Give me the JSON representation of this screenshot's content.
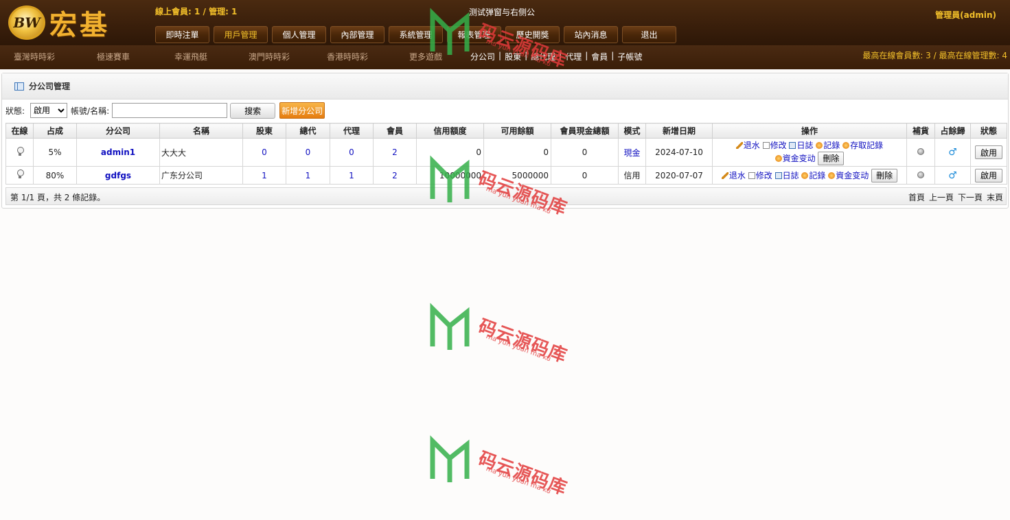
{
  "header": {
    "logo_badge": "BW",
    "logo_text": "宏基",
    "online_info": "線上會員: 1 / 管理: 1",
    "page_caption": "测试弹窗与右侧公",
    "admin_label": "管理員(admin)",
    "menu": [
      {
        "label": "即時注單",
        "active": false
      },
      {
        "label": "用戶管理",
        "active": true
      },
      {
        "label": "個人管理",
        "active": false
      },
      {
        "label": "內部管理",
        "active": false
      },
      {
        "label": "系統管理",
        "active": false
      },
      {
        "label": "報表管理",
        "active": false
      },
      {
        "label": "歷史開獎",
        "active": false
      },
      {
        "label": "站內消息",
        "active": false
      },
      {
        "label": "退出",
        "active": false
      }
    ]
  },
  "subnav": {
    "games": [
      "臺灣時時彩",
      "極速賽車",
      "幸運飛艇",
      "澳門時時彩",
      "香港時時彩",
      "更多遊戲"
    ],
    "links": [
      "分公司",
      "股東",
      "總代理",
      "代理",
      "會員",
      "子帳號"
    ],
    "max_info": "最高在線會員數: 3 / 最高在線管理數: 4"
  },
  "panel": {
    "title": "分公司管理"
  },
  "search": {
    "status_label": "狀態:",
    "status_selected": "啟用",
    "account_label": "帳號/名稱:",
    "account_value": "",
    "search_label": "搜索",
    "add_label": "新增分公司"
  },
  "table": {
    "headers": [
      "在線",
      "占成",
      "分公司",
      "名稱",
      "股東",
      "總代",
      "代理",
      "會員",
      "信用額度",
      "可用餘額",
      "會員現金總額",
      "模式",
      "新增日期",
      "操作",
      "補貨",
      "占餘歸",
      "狀態"
    ],
    "rows": [
      {
        "share": "5%",
        "company": "admin1",
        "name": "大大大",
        "shareholder": "0",
        "general_agent": "0",
        "agent": "0",
        "member": "2",
        "credit": "0",
        "available": "0",
        "cash_total": "0",
        "mode": "現金",
        "date": "2024-07-10",
        "ops": [
          "退水",
          "修改",
          "日誌",
          "記錄",
          "存取記錄",
          "資金变动"
        ],
        "delete_label": "刪除",
        "status_label": "啟用"
      },
      {
        "share": "80%",
        "company": "gdfgs",
        "name": "广东分公司",
        "shareholder": "1",
        "general_agent": "1",
        "agent": "1",
        "member": "2",
        "credit": "10000000",
        "available": "5000000",
        "cash_total": "0",
        "mode": "信用",
        "date": "2020-07-07",
        "ops": [
          "退水",
          "修改",
          "日誌",
          "記錄",
          "資金变动"
        ],
        "delete_label": "刪除",
        "status_label": "啟用"
      }
    ]
  },
  "footer": {
    "pager_info": "第 1/1 頁，共 2 條記錄。",
    "pager": [
      "首頁",
      "上一頁",
      "下一頁",
      "末頁"
    ]
  },
  "watermark": {
    "text": "码云源码库",
    "sub": "ma yun yuan ma ku"
  },
  "colors": {
    "header_bg": "#3a1f0b",
    "gold": "#f3c02a",
    "link_blue": "#1010c0",
    "add_orange": "#e57c10"
  }
}
